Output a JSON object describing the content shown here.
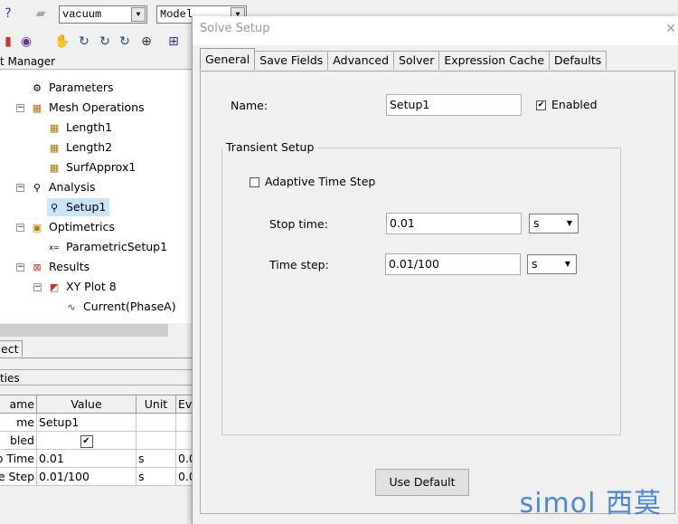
{
  "toolbar": {
    "material_combo": "vacuum",
    "view_combo": "Model"
  },
  "project_manager": {
    "title": "t Manager"
  },
  "tree": [
    {
      "label": "Parameters",
      "icon": "parameters-icon"
    },
    {
      "label": "Mesh Operations",
      "icon": "mesh-icon"
    },
    {
      "label": "Length1",
      "icon": "mesh-icon"
    },
    {
      "label": "Length2",
      "icon": "mesh-icon"
    },
    {
      "label": "SurfApprox1",
      "icon": "mesh-icon"
    },
    {
      "label": "Analysis",
      "icon": "analysis-icon"
    },
    {
      "label": "Setup1",
      "icon": "setup-icon",
      "selected": true
    },
    {
      "label": "Optimetrics",
      "icon": "optimetrics-icon"
    },
    {
      "label": "ParametricSetup1",
      "icon": "parametric-icon"
    },
    {
      "label": "Results",
      "icon": "results-icon"
    },
    {
      "label": "XY Plot 8",
      "icon": "xy-plot-icon"
    },
    {
      "label": "Current(PhaseA)",
      "icon": "trace-icon"
    }
  ],
  "project_tab": "ect",
  "properties": {
    "title": "ties",
    "columns": [
      "ame",
      "Value",
      "Unit",
      "Eva"
    ],
    "rows": [
      [
        "me",
        "Setup1",
        "",
        ""
      ],
      [
        "bled",
        "",
        "",
        ""
      ],
      [
        "p Time",
        "0.01",
        "s",
        "0.0"
      ],
      [
        "e Step",
        "0.01/100",
        "s",
        "0.0"
      ]
    ],
    "enabled_checked": true
  },
  "dialog": {
    "title": "Solve Setup",
    "tabs": [
      "General",
      "Save Fields",
      "Advanced",
      "Solver",
      "Expression Cache",
      "Defaults"
    ],
    "active_tab": "General",
    "name_label": "Name:",
    "name_value": "Setup1",
    "enabled_label": "Enabled",
    "enabled_checked": true,
    "group_title": "Transient Setup",
    "adaptive_label": "Adaptive Time Step",
    "adaptive_checked": false,
    "stop_time_label": "Stop time:",
    "stop_time_value": "0.01",
    "stop_time_unit": "s",
    "time_step_label": "Time step:",
    "time_step_value": "0.01/100",
    "time_step_unit": "s",
    "use_default_label": "Use Default"
  },
  "watermark": "simol 西莫"
}
